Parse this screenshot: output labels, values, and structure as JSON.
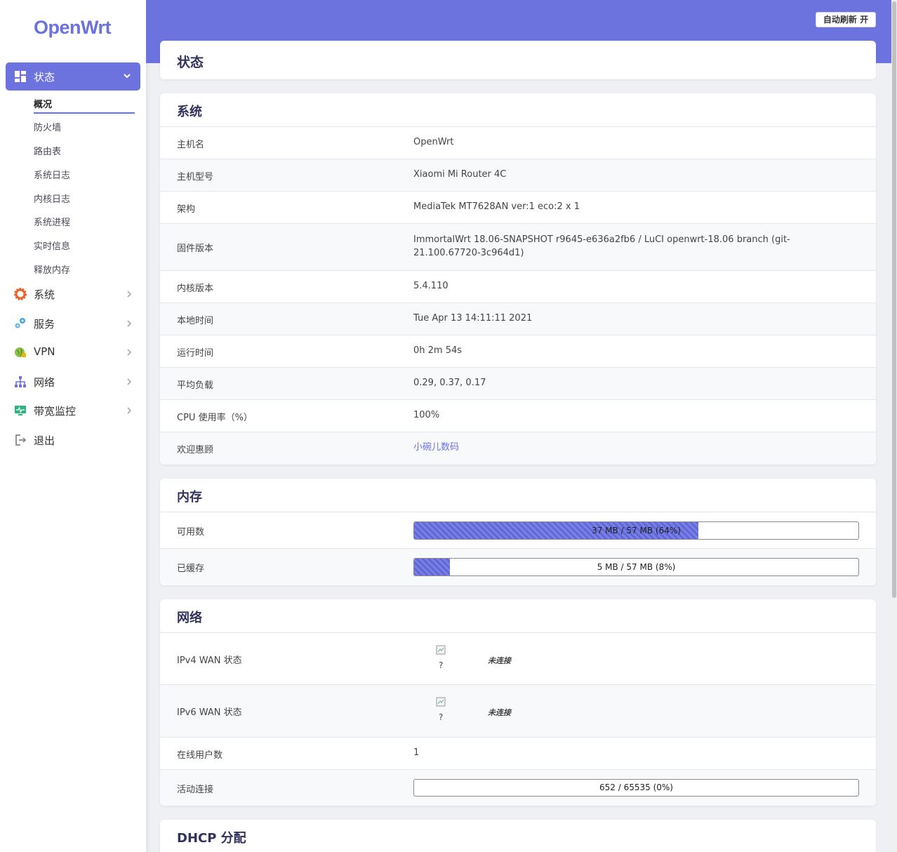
{
  "brand": {
    "logo": "OpenWrt",
    "accent": "#6c72de"
  },
  "header": {
    "refresh_button": "自动刷新 开"
  },
  "sidebar": {
    "active": {
      "label": "状态",
      "icon": "dashboard-icon"
    },
    "subitems": [
      "概况",
      "防火墙",
      "路由表",
      "系统日志",
      "内核日志",
      "系统进程",
      "实时信息",
      "释放内存"
    ],
    "items": [
      {
        "label": "系统",
        "icon": "gear-icon",
        "icon_color": "#e8622c"
      },
      {
        "label": "服务",
        "icon": "services-icon",
        "icon_color": "#3fa7dc"
      },
      {
        "label": "VPN",
        "icon": "vpn-globe-icon",
        "icon_color": "#8bc34a"
      },
      {
        "label": "网络",
        "icon": "network-icon",
        "icon_color": "#6c72de"
      },
      {
        "label": "带宽监控",
        "icon": "monitor-icon",
        "icon_color": "#2fb380"
      },
      {
        "label": "退出",
        "icon": "logout-icon",
        "icon_color": "#888888"
      }
    ]
  },
  "page_title": "状态",
  "system": {
    "title": "系统",
    "rows": [
      {
        "key": "主机名",
        "value": "OpenWrt"
      },
      {
        "key": "主机型号",
        "value": "Xiaomi Mi Router 4C"
      },
      {
        "key": "架构",
        "value": "MediaTek MT7628AN ver:1 eco:2 x 1"
      },
      {
        "key": "固件版本",
        "value": "ImmortalWrt 18.06-SNAPSHOT r9645-e636a2fb6 / LuCI openwrt-18.06 branch (git-21.100.67720-3c964d1)"
      },
      {
        "key": "内核版本",
        "value": "5.4.110"
      },
      {
        "key": "本地时间",
        "value": "Tue Apr 13 14:11:11 2021"
      },
      {
        "key": "运行时间",
        "value": "0h 2m 54s"
      },
      {
        "key": "平均负载",
        "value": "0.29, 0.37, 0.17"
      },
      {
        "key": "CPU 使用率（%）",
        "value": "100%"
      },
      {
        "key": "欢迎惠顾",
        "value": "小碗儿数码"
      }
    ]
  },
  "memory": {
    "title": "内存",
    "rows": [
      {
        "key": "可用数",
        "text": "37 MB / 57 MB (64%)",
        "percent": 64
      },
      {
        "key": "已缓存",
        "text": "5 MB / 57 MB (8%)",
        "percent": 8
      }
    ]
  },
  "network": {
    "title": "网络",
    "ipv4": {
      "key": "IPv4 WAN 状态",
      "icon": "broken-image-icon",
      "q": "?",
      "status": "未连接"
    },
    "ipv6": {
      "key": "IPv6 WAN 状态",
      "icon": "broken-image-icon",
      "q": "?",
      "status": "未连接"
    },
    "online_users": {
      "key": "在线用户数",
      "value": "1"
    },
    "connections": {
      "key": "活动连接",
      "text": "652 / 65535 (0%)",
      "percent": 0
    }
  },
  "dhcp": {
    "title": "DHCP 分配"
  }
}
